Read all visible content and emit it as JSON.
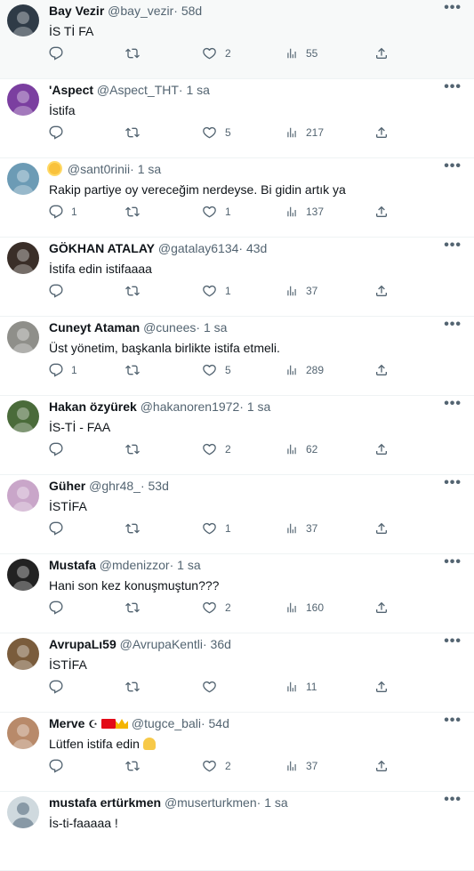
{
  "tweets": [
    {
      "name": "Bay Vezir",
      "handle": "@bay_vezir",
      "time": "58d",
      "text": "İS Tİ FA",
      "replies": "",
      "retweets": "",
      "likes": "2",
      "views": "55",
      "avatar_color": "#2f3b47"
    },
    {
      "name": "'Aspect",
      "handle": "@Aspect_THT",
      "time": "1 sa",
      "text": "İstifa",
      "replies": "",
      "retweets": "",
      "likes": "5",
      "views": "217",
      "avatar_color": "#7b3fa0"
    },
    {
      "name": "",
      "handle": "@sant0rinii",
      "time": "1 sa",
      "text": "Rakip partiye oy vereceğim nerdeyse. Bi gidin artık ya",
      "replies": "1",
      "retweets": "",
      "likes": "1",
      "views": "137",
      "avatar_color": "#6c9bb5"
    },
    {
      "name": "GÖKHAN ATALAY",
      "handle": "@gatalay6134",
      "time": "43d",
      "text": "İstifa edin istifaaaa",
      "replies": "",
      "retweets": "",
      "likes": "1",
      "views": "37",
      "avatar_color": "#3a2e28"
    },
    {
      "name": "Cuneyt Ataman",
      "handle": "@cunees",
      "time": "1 sa",
      "text": "Üst yönetim, başkanla birlikte istifa etmeli.",
      "replies": "1",
      "retweets": "",
      "likes": "5",
      "views": "289",
      "avatar_color": "#8f8f8a"
    },
    {
      "name": "Hakan özyürek",
      "handle": "@hakanoren1972",
      "time": "1 sa",
      "text": "İS-Tİ - FAA",
      "replies": "",
      "retweets": "",
      "likes": "2",
      "views": "62",
      "avatar_color": "#4a6b3a"
    },
    {
      "name": "Güher",
      "handle": "@ghr48_",
      "time": "53d",
      "text": "İSTİFA",
      "replies": "",
      "retweets": "",
      "likes": "1",
      "views": "37",
      "avatar_color": "#c9a6c9"
    },
    {
      "name": "Mustafa",
      "handle": "@mdenizzor",
      "time": "1 sa",
      "text": "Hani son kez konuşmuştun???",
      "replies": "",
      "retweets": "",
      "likes": "2",
      "views": "160",
      "avatar_color": "#222222"
    },
    {
      "name": "AvrupaLı59",
      "handle": "@AvrupaKentli",
      "time": "36d",
      "text": "İSTİFA",
      "replies": "",
      "retweets": "",
      "likes": "",
      "views": "11",
      "avatar_color": "#7a5c3c"
    },
    {
      "name": "Merve",
      "handle": "@tugce_bali",
      "time": "54d",
      "text": "Lütfen istifa edin",
      "replies": "",
      "retweets": "",
      "likes": "2",
      "views": "37",
      "avatar_color": "#b88a6a"
    },
    {
      "name": "mustafa ertürkmen",
      "handle": "@muserturkmen",
      "time": "1 sa",
      "text": "İs-ti-faaaaa !",
      "replies": "",
      "retweets": "",
      "likes": "",
      "views": "",
      "avatar_color": "#cfd9de"
    }
  ],
  "separator_dot": "·",
  "more_glyph": "•••",
  "merve_extra": {
    "moon": "☪"
  }
}
